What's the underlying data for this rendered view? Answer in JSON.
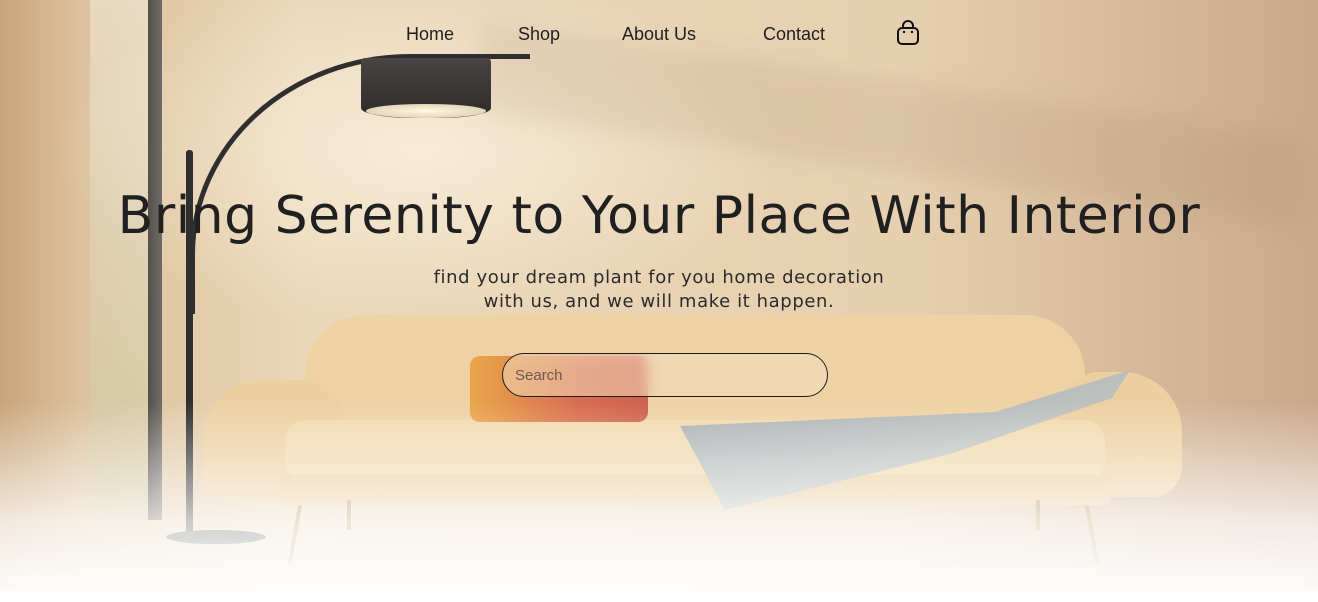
{
  "nav": {
    "items": [
      {
        "label": "Home"
      },
      {
        "label": "Shop"
      },
      {
        "label": "About Us"
      },
      {
        "label": "Contact"
      }
    ],
    "cart_icon": "shopping-bag-icon"
  },
  "hero": {
    "title": "Bring Serenity to Your Place With Interior",
    "subtitle_line1": "find your dream plant for you home decoration",
    "subtitle_line2": "with us, and we will make it happen.",
    "background_image": "living-room-sofa-floor-lamp-photo"
  },
  "search": {
    "placeholder": "Search",
    "value": ""
  },
  "colors": {
    "text": "#1f1f1f",
    "background": "#e7d2b3"
  }
}
